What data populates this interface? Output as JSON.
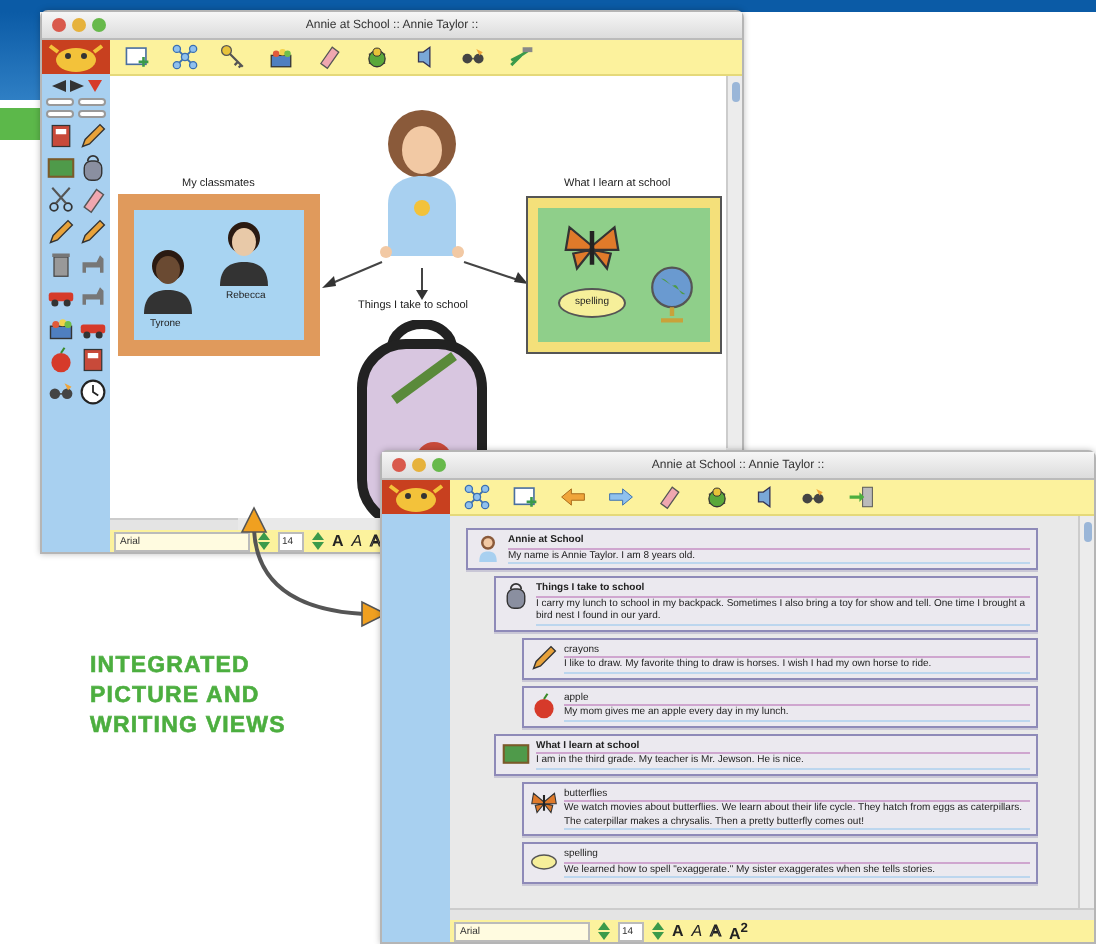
{
  "picture_window": {
    "title": "Annie at School :: Annie Taylor ::",
    "canvas": {
      "classmates_label": "My classmates",
      "classmates": [
        "Tyrone",
        "Rebecca"
      ],
      "things_label": "Things I take to school",
      "learn_label": "What I learn at school",
      "spelling_label": "spelling"
    },
    "font_bar": {
      "font": "Arial",
      "size": "14",
      "styles": [
        {
          "label": "A",
          "kind": "bold"
        },
        {
          "label": "A",
          "kind": "italic"
        },
        {
          "label": "A",
          "kind": "outline"
        }
      ]
    }
  },
  "caption": [
    "INTEGRATED",
    "PICTURE AND",
    "WRITING VIEWS"
  ],
  "writing_window": {
    "title": "Annie at School :: Annie Taylor ::",
    "outline": [
      {
        "title": "Annie at School",
        "text": "My name is Annie Taylor. I am 8 years old.",
        "children": [
          {
            "title": "Things I take to school",
            "text": "I carry my lunch to school in my backpack. Sometimes I also bring a toy for show and tell. One time I brought a bird nest I found in our yard.",
            "children": [
              {
                "title": "crayons",
                "text": "I like to draw. My favorite thing to draw is horses. I wish I had my own horse to ride."
              },
              {
                "title": "apple",
                "text": "My mom gives me an apple every day in my lunch."
              }
            ]
          },
          {
            "title": "What I learn at school",
            "text": "I am in the third grade. My teacher is Mr. Jewson. He is nice.",
            "children": [
              {
                "title": "butterflies",
                "text": "We watch movies about butterflies. We learn about their life cycle. They hatch from eggs as caterpillars. The caterpillar makes a chrysalis. Then a pretty butterfly comes out!"
              },
              {
                "title": "spelling",
                "text": "We learned how to spell \"exaggerate.\" My sister exaggerates when she tells stories."
              }
            ]
          }
        ]
      }
    ],
    "font_bar": {
      "font": "Arial",
      "size": "14",
      "styles": [
        {
          "label": "A",
          "kind": "bold"
        },
        {
          "label": "A",
          "kind": "italic"
        },
        {
          "label": "A",
          "kind": "outline"
        },
        {
          "label": "A$^{2}$",
          "kind": "superscript"
        }
      ]
    }
  }
}
